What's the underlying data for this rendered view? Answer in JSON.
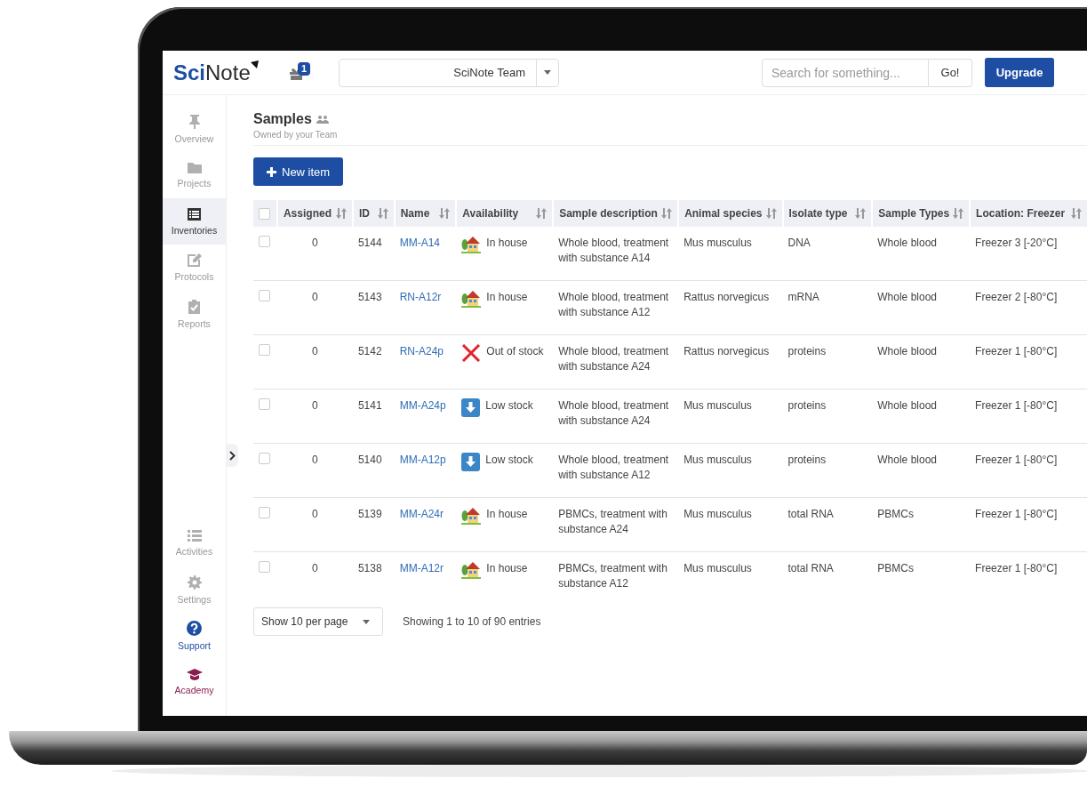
{
  "header": {
    "logo": "**Sci**Note",
    "notification_badge": "1",
    "team": "SciNote Team",
    "search": {
      "placeholder": "Search for something..."
    },
    "search_button": "Go!",
    "upgrade_button": "Upgrade"
  },
  "sidebar": {
    "items": [
      {
        "label": "Overview",
        "selected": false
      },
      {
        "label": "Projects",
        "selected": false
      },
      {
        "label": "Inventories",
        "selected": true
      },
      {
        "label": "Protocols",
        "selected": false
      },
      {
        "label": "Reports",
        "selected": false
      }
    ],
    "bottom_items": [
      {
        "label": "Activities",
        "kind": "default"
      },
      {
        "label": "Settings",
        "kind": "default"
      },
      {
        "label": "Support",
        "kind": "support"
      },
      {
        "label": "Academy",
        "kind": "academy"
      }
    ]
  },
  "page": {
    "title": "Samples",
    "subtitle": "Owned by your Team",
    "new_item_button": "New item"
  },
  "table": {
    "select_all": {
      "checked": false
    },
    "columns": [
      "Assigned",
      "ID",
      "Name",
      "Availability",
      "Sample description",
      "Animal species",
      "Isolate type",
      "Sample Types",
      "Location: Freezer"
    ],
    "rows": [
      {
        "checked": false,
        "assigned": "0",
        "id": "5144",
        "name": "MM-A14",
        "availability": {
          "kind": "in_house",
          "label": "In house"
        },
        "description": "Whole blood, treatment with substance A14",
        "species": "Mus musculus",
        "isolate": "DNA",
        "sample_type": "Whole blood",
        "location": "Freezer 3 [-20°C]"
      },
      {
        "checked": false,
        "assigned": "0",
        "id": "5143",
        "name": "RN-A12r",
        "availability": {
          "kind": "in_house",
          "label": "In house"
        },
        "description": "Whole blood, treatment with substance A12",
        "species": "Rattus norvegicus",
        "isolate": "mRNA",
        "sample_type": "Whole blood",
        "location": "Freezer 2 [-80°C]"
      },
      {
        "checked": false,
        "assigned": "0",
        "id": "5142",
        "name": "RN-A24p",
        "availability": {
          "kind": "out_of_stock",
          "label": "Out of stock"
        },
        "description": "Whole blood, treatment with substance A24",
        "species": "Rattus norvegicus",
        "isolate": "proteins",
        "sample_type": "Whole blood",
        "location": "Freezer 1 [-80°C]"
      },
      {
        "checked": false,
        "assigned": "0",
        "id": "5141",
        "name": "MM-A24p",
        "availability": {
          "kind": "low_stock",
          "label": "Low stock"
        },
        "description": "Whole blood, treatment with substance A24",
        "species": "Mus musculus",
        "isolate": "proteins",
        "sample_type": "Whole blood",
        "location": "Freezer 1 [-80°C]"
      },
      {
        "checked": false,
        "assigned": "0",
        "id": "5140",
        "name": "MM-A12p",
        "availability": {
          "kind": "low_stock",
          "label": "Low stock"
        },
        "description": "Whole blood, treatment with substance A12",
        "species": "Mus musculus",
        "isolate": "proteins",
        "sample_type": "Whole blood",
        "location": "Freezer 1 [-80°C]"
      },
      {
        "checked": false,
        "assigned": "0",
        "id": "5139",
        "name": "MM-A24r",
        "availability": {
          "kind": "in_house",
          "label": "In house"
        },
        "description": "PBMCs, treatment with substance A24",
        "species": "Mus musculus",
        "isolate": "total RNA",
        "sample_type": "PBMCs",
        "location": "Freezer 1 [-80°C]"
      },
      {
        "checked": false,
        "assigned": "0",
        "id": "5138",
        "name": "MM-A12r",
        "availability": {
          "kind": "in_house",
          "label": "In house"
        },
        "description": "PBMCs, treatment with substance A12",
        "species": "Mus musculus",
        "isolate": "total RNA",
        "sample_type": "PBMCs",
        "location": "Freezer 1 [-80°C]"
      }
    ]
  },
  "pagination": {
    "page_size": "Show 10 per page",
    "summary": "Showing 1 to 10 of 90 entries"
  }
}
